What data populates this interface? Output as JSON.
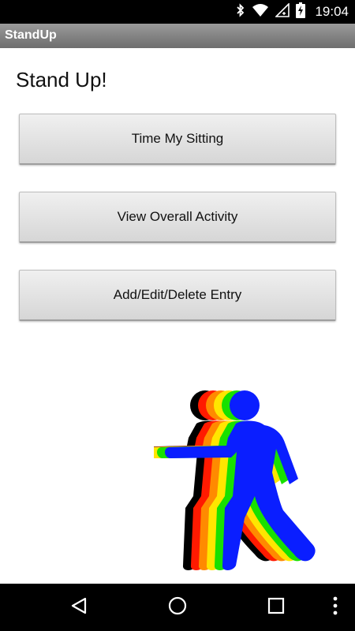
{
  "status_bar": {
    "time": "19:04",
    "icons": [
      "bluetooth-icon",
      "wifi-icon",
      "signal-icon",
      "battery-charging-icon"
    ]
  },
  "action_bar": {
    "title": "StandUp"
  },
  "main": {
    "heading": "Stand Up!",
    "buttons": [
      {
        "label": "Time My Sitting"
      },
      {
        "label": "View Overall Activity"
      },
      {
        "label": "Add/Edit/Delete Entry"
      }
    ],
    "illustration": "rainbow-walking-person-icon"
  },
  "nav_bar": {
    "icons": [
      "back-icon",
      "home-icon",
      "recents-icon",
      "overflow-menu-icon"
    ]
  },
  "colors": {
    "status_bar": "#000000",
    "action_bar": "#7f7f7f",
    "walker_front": "#0a1eff",
    "rainbow": [
      "#000000",
      "#ff1a00",
      "#ff8a00",
      "#ffe600",
      "#18e000",
      "#0a1eff"
    ]
  }
}
